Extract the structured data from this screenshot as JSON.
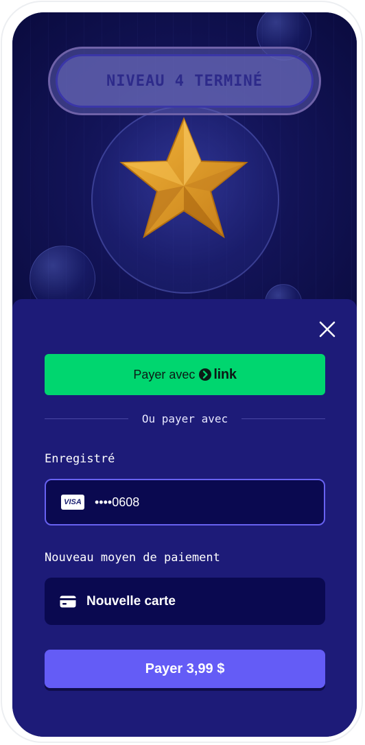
{
  "game": {
    "level_banner": "NIVEAU 4 TERMINÉ"
  },
  "payment": {
    "link_button_prefix": "Payer avec",
    "link_button_brand": "link",
    "divider_text": "Ou payer avec",
    "saved_label": "Enregistré",
    "saved_card": {
      "brand": "VISA",
      "masked_number": "••••0608"
    },
    "new_method_label": "Nouveau moyen de paiement",
    "new_card_label": "Nouvelle carte",
    "pay_button_label": "Payer 3,99 $"
  },
  "colors": {
    "link_green": "#00d66f",
    "sheet_bg": "#1d1b78",
    "field_bg": "#0a0950",
    "accent": "#645cf6"
  }
}
